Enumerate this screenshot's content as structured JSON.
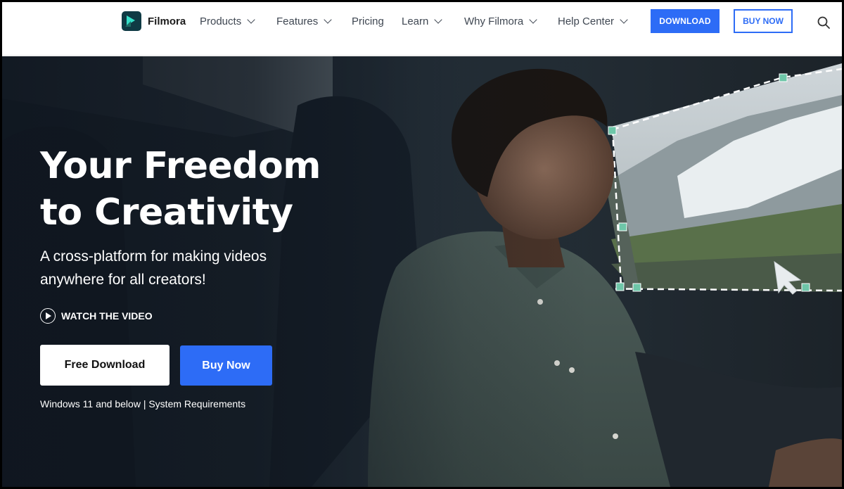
{
  "brand": {
    "name": "Filmora"
  },
  "nav": {
    "items": [
      {
        "label": "Products",
        "dropdown": true
      },
      {
        "label": "Features",
        "dropdown": true
      },
      {
        "label": "Pricing",
        "dropdown": false
      },
      {
        "label": "Learn",
        "dropdown": true
      },
      {
        "label": "Why Filmora",
        "dropdown": true
      },
      {
        "label": "Help Center",
        "dropdown": true
      }
    ],
    "download_label": "DOWNLOAD",
    "buy_label": "BUY NOW",
    "search_icon": "search-icon"
  },
  "hero": {
    "title_line1": "Your Freedom",
    "title_line2": "to Creativity",
    "subtitle": "A cross-platform for making videos anywhere for all creators!",
    "watch_label": "WATCH THE VIDEO",
    "free_download_label": "Free Download",
    "buy_now_label": "Buy Now",
    "requirements": "Windows 11 and below | System Requirements"
  },
  "colors": {
    "accent": "#2d6cf6",
    "hero_text": "#ffffff",
    "logo_dark": "#0f3a44",
    "logo_teal": "#35e0c8"
  }
}
